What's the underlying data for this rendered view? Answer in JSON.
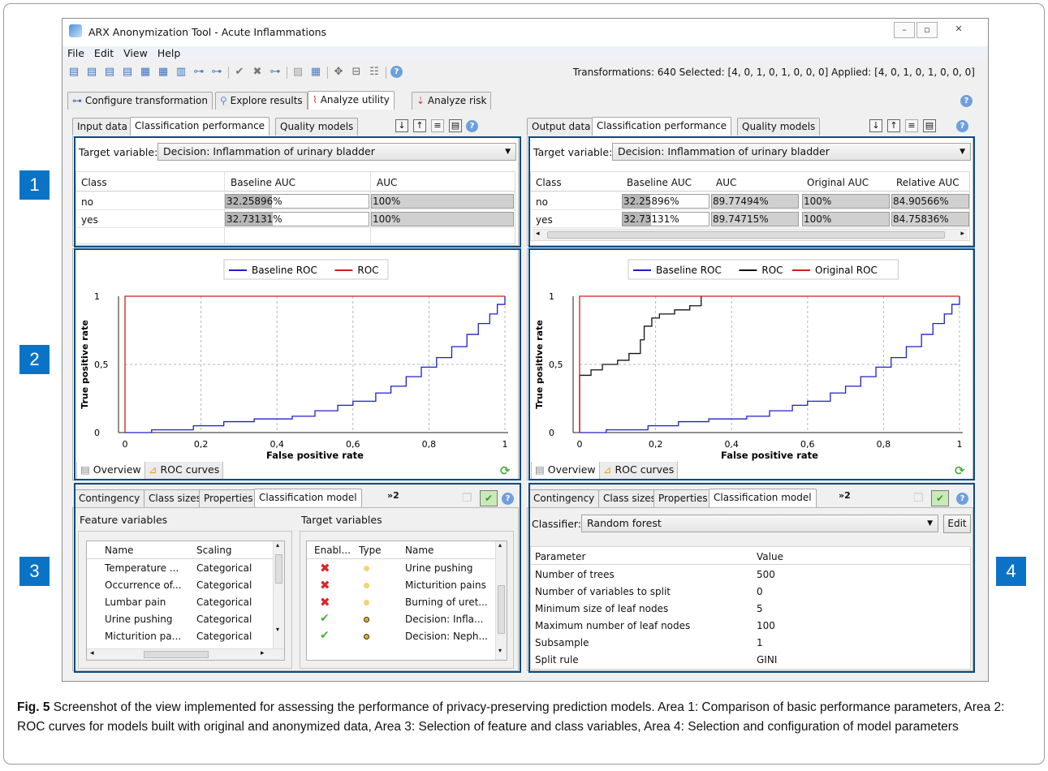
{
  "window": {
    "title": "ARX Anonymization Tool - Acute Inflammations"
  },
  "menu": [
    "File",
    "Edit",
    "View",
    "Help"
  ],
  "status": {
    "text": "Transformations: 640   Selected: [4, 0, 1, 0, 1, 0, 0, 0]   Applied: [4, 0, 1, 0, 1, 0, 0, 0]"
  },
  "main_tabs": [
    "Configure transformation",
    "Explore results",
    "Analyze utility",
    "Analyze risk"
  ],
  "left": {
    "tabs": [
      "Input data",
      "Classification performance",
      "Quality models"
    ],
    "target_label": "Target variable:",
    "target_value": "Decision: Inflammation of urinary bladder",
    "columns": [
      "Class",
      "Baseline AUC",
      "AUC"
    ],
    "rows": [
      {
        "cls": "no",
        "baseline": "32.25896%",
        "baseline_frac": 0.3226,
        "auc": "100%"
      },
      {
        "cls": "yes",
        "baseline": "32.73131%",
        "baseline_frac": 0.3273,
        "auc": "100%"
      }
    ],
    "legend": [
      "Baseline ROC",
      "ROC"
    ],
    "bottom_tabs": [
      "Overview",
      "ROC curves"
    ]
  },
  "right": {
    "tabs": [
      "Output data",
      "Classification performance",
      "Quality models"
    ],
    "target_label": "Target variable:",
    "target_value": "Decision: Inflammation of urinary bladder",
    "columns": [
      "Class",
      "Baseline AUC",
      "AUC",
      "Original AUC",
      "Relative AUC"
    ],
    "rows": [
      {
        "cls": "no",
        "baseline": "32.25896%",
        "auc": "89.77494%",
        "orig": "100%",
        "rel": "84.90566%"
      },
      {
        "cls": "yes",
        "baseline": "32.73131%",
        "auc": "89.74715%",
        "orig": "100%",
        "rel": "84.75836%"
      }
    ],
    "legend": [
      "Baseline ROC",
      "ROC",
      "Original ROC"
    ],
    "bottom_tabs": [
      "Overview",
      "ROC curves"
    ]
  },
  "chart_axes": {
    "xlabel": "False positive rate",
    "ylabel": "True positive rate",
    "xticks": [
      "0",
      "0,2",
      "0,4",
      "0,6",
      "0,8",
      "1"
    ],
    "yticks": [
      "0",
      "0,5",
      "1"
    ]
  },
  "chart_data": [
    {
      "type": "line",
      "title": "",
      "xlabel": "False positive rate",
      "ylabel": "True positive rate",
      "xlim": [
        0,
        1
      ],
      "ylim": [
        0,
        1
      ],
      "grid": true,
      "legend": "top-center",
      "series": [
        {
          "name": "Baseline ROC",
          "color": "#1f1fd0",
          "x": [
            0,
            0.07,
            0.07,
            0.18,
            0.26,
            0.34,
            0.44,
            0.5,
            0.56,
            0.6,
            0.66,
            0.7,
            0.74,
            0.78,
            0.82,
            0.86,
            0.9,
            0.93,
            0.96,
            0.98,
            1.0
          ],
          "y": [
            0,
            0,
            0.02,
            0.05,
            0.08,
            0.1,
            0.12,
            0.16,
            0.2,
            0.23,
            0.29,
            0.34,
            0.41,
            0.48,
            0.55,
            0.63,
            0.72,
            0.8,
            0.87,
            0.94,
            1.0
          ]
        },
        {
          "name": "ROC",
          "color": "#d61a1a",
          "x": [
            0,
            0,
            1
          ],
          "y": [
            0,
            1,
            1
          ]
        }
      ]
    },
    {
      "type": "line",
      "title": "",
      "xlabel": "False positive rate",
      "ylabel": "True positive rate",
      "xlim": [
        0,
        1
      ],
      "ylim": [
        0,
        1
      ],
      "grid": true,
      "legend": "top-center",
      "series": [
        {
          "name": "Baseline ROC",
          "color": "#1f1fd0",
          "x": [
            0,
            0.07,
            0.07,
            0.18,
            0.26,
            0.34,
            0.44,
            0.5,
            0.56,
            0.6,
            0.66,
            0.7,
            0.74,
            0.78,
            0.82,
            0.86,
            0.9,
            0.93,
            0.96,
            0.98,
            1.0
          ],
          "y": [
            0,
            0,
            0.02,
            0.05,
            0.08,
            0.1,
            0.12,
            0.16,
            0.2,
            0.23,
            0.29,
            0.34,
            0.41,
            0.48,
            0.55,
            0.63,
            0.72,
            0.8,
            0.87,
            0.94,
            1.0
          ]
        },
        {
          "name": "ROC",
          "color": "#111111",
          "x": [
            0,
            0,
            0.03,
            0.06,
            0.1,
            0.13,
            0.16,
            0.17,
            0.19,
            0.21,
            0.25,
            0.29,
            0.32,
            0.32
          ],
          "y": [
            0,
            0.42,
            0.46,
            0.5,
            0.53,
            0.58,
            0.68,
            0.78,
            0.84,
            0.87,
            0.9,
            0.93,
            0.95,
            1.0
          ]
        },
        {
          "name": "Original ROC",
          "color": "#d61a1a",
          "x": [
            0,
            0,
            1
          ],
          "y": [
            0,
            1,
            1
          ]
        }
      ]
    }
  ],
  "left_bottom": {
    "tabs": [
      "Contingency",
      "Class sizes",
      "Properties",
      "Classification model",
      "»2"
    ],
    "feature_title": "Feature variables",
    "target_title": "Target variables",
    "feature_columns": [
      "Name",
      "Scaling"
    ],
    "features": [
      {
        "name": "Temperature ...",
        "scaling": "Categorical"
      },
      {
        "name": "Occurrence of...",
        "scaling": "Categorical"
      },
      {
        "name": "Lumbar pain",
        "scaling": "Categorical"
      },
      {
        "name": "Urine pushing",
        "scaling": "Categorical"
      },
      {
        "name": "Micturition pa...",
        "scaling": "Categorical"
      }
    ],
    "target_columns": [
      "Enabl...",
      "Type",
      "Name"
    ],
    "targets": [
      {
        "enabled": false,
        "name": "Urine pushing"
      },
      {
        "enabled": false,
        "name": "Micturition pains"
      },
      {
        "enabled": false,
        "name": "Burning of uret..."
      },
      {
        "enabled": true,
        "name": "Decision: Infla..."
      },
      {
        "enabled": true,
        "name": "Decision: Neph..."
      }
    ]
  },
  "right_bottom": {
    "tabs": [
      "Contingency",
      "Class sizes",
      "Properties",
      "Classification model",
      "»2"
    ],
    "classifier_label": "Classifier:",
    "classifier_value": "Random forest",
    "edit_label": "Edit",
    "columns": [
      "Parameter",
      "Value"
    ],
    "params": [
      {
        "p": "Number of trees",
        "v": "500"
      },
      {
        "p": "Number of variables to split",
        "v": "0"
      },
      {
        "p": "Minimum size of leaf nodes",
        "v": "5"
      },
      {
        "p": "Maximum number of leaf nodes",
        "v": "100"
      },
      {
        "p": "Subsample",
        "v": "1"
      },
      {
        "p": "Split rule",
        "v": "GINI"
      }
    ]
  },
  "areas": [
    "1",
    "2",
    "3",
    "4"
  ],
  "caption": {
    "label": "Fig. 5",
    "text": " Screenshot of the view implemented for assessing the performance of privacy-preserving prediction models. Area 1: Comparison of basic performance parameters, Area 2: ROC curves for models built with original and anonymized data, Area 3: Selection of feature and class variables, Area 4: Selection and configuration of model parameters"
  }
}
